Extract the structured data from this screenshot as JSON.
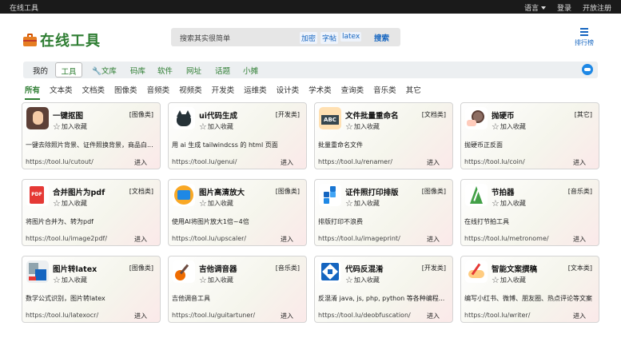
{
  "topbar": {
    "brand": "在线工具",
    "language": "语言",
    "login": "登录",
    "open_register": "开放注册"
  },
  "logo": {
    "text": "在线工具"
  },
  "search": {
    "placeholder": "搜索其实很简单",
    "keywords": [
      "加密",
      "字帖",
      "latex"
    ],
    "button": "搜索"
  },
  "ranking": {
    "label": "排行榜"
  },
  "nav": {
    "items": [
      "我的",
      "工具",
      "文库",
      "码库",
      "软件",
      "网址",
      "话题",
      "小摊"
    ],
    "active": "工具"
  },
  "categories": {
    "items": [
      "所有",
      "文本类",
      "文档类",
      "图像类",
      "音频类",
      "视频类",
      "开发类",
      "运维类",
      "设计类",
      "学术类",
      "查询类",
      "音乐类",
      "其它"
    ],
    "selected": "所有"
  },
  "favorite_label": "加入收藏",
  "enter_label": "进入",
  "tools": [
    {
      "name": "一键抠图",
      "tag": "[图像类]",
      "desc": "一键去除照片背景、证件照换背景，商品白...",
      "url": "https://tool.lu/cutout/",
      "icon": "portrait-icon"
    },
    {
      "name": "ui代码生成",
      "tag": "[开发类]",
      "desc": "用 ai 生成 tailwindcss 的 html 页面",
      "url": "https://tool.lu/genui/",
      "icon": "cat-icon"
    },
    {
      "name": "文件批量重命名",
      "tag": "[文档类]",
      "desc": "批量重命名文件",
      "url": "https://tool.lu/renamer/",
      "icon": "abc-icon"
    },
    {
      "name": "抛硬币",
      "tag": "[其它]",
      "desc": "抛硬币正反面",
      "url": "https://tool.lu/coin/",
      "icon": "coin-icon"
    },
    {
      "name": "合并图片为pdf",
      "tag": "[文档类]",
      "desc": "将图片合并为、转为pdf",
      "url": "https://tool.lu/image2pdf/",
      "icon": "pdf-icon"
    },
    {
      "name": "图片高清放大",
      "tag": "[图像类]",
      "desc": "使用AI将图片放大1倍~4倍",
      "url": "https://tool.lu/upscaler/",
      "icon": "image-icon"
    },
    {
      "name": "证件照打印排版",
      "tag": "[图像类]",
      "desc": "排版打印不浪费",
      "url": "https://tool.lu/imageprint/",
      "icon": "grid-icon"
    },
    {
      "name": "节拍器",
      "tag": "[音乐类]",
      "desc": "在线打节拍工具",
      "url": "https://tool.lu/metronome/",
      "icon": "metronome-icon"
    },
    {
      "name": "图片转latex",
      "tag": "[图像类]",
      "desc": "数学公式识别，图片转latex",
      "url": "https://tool.lu/latexocr/",
      "icon": "formula-icon"
    },
    {
      "name": "吉他调音器",
      "tag": "[音乐类]",
      "desc": "吉他调音工具",
      "url": "https://tool.lu/guitartuner/",
      "icon": "guitar-icon"
    },
    {
      "name": "代码反混淆",
      "tag": "[开发类]",
      "desc": "反混淆 java, js, php, python 等各种编程...",
      "url": "https://tool.lu/deobfuscation/",
      "icon": "code-icon"
    },
    {
      "name": "智能文案撰稿",
      "tag": "[文本类]",
      "desc": "编写小红书、微博、朋友圈、热点评论等文案",
      "url": "https://tool.lu/writer/",
      "icon": "writing-icon"
    }
  ]
}
